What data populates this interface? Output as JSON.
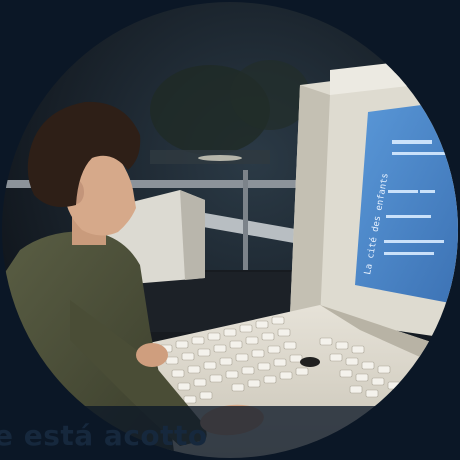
{
  "caption": {
    "text": "e está acotto"
  },
  "screen_text": {
    "title": "La cité des enfants"
  },
  "colors": {
    "background": "#0b1726",
    "terminal_screen": "#4a86c8",
    "terminal_body": "#dcd8cc",
    "shirt": "#4d5139",
    "hair": "#2e1f17"
  }
}
